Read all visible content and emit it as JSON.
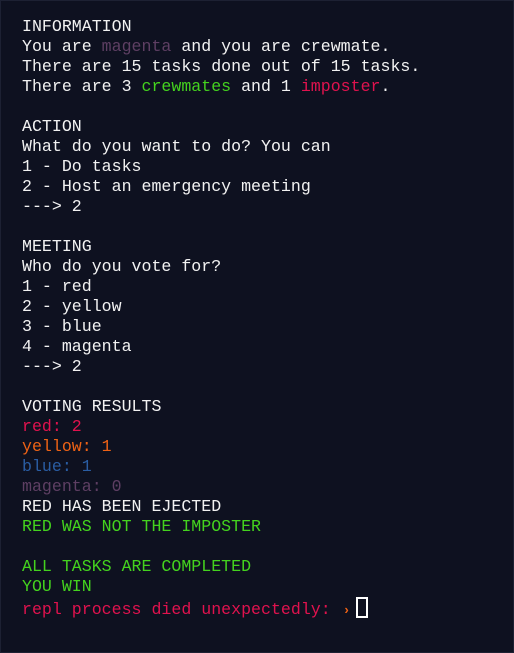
{
  "colors": {
    "background": "#0e1120",
    "text": "#f2f2f2",
    "magenta": "#5e3f63",
    "green": "#44d21e",
    "red": "#e0124e",
    "yellow": "#ee6215",
    "blue": "#2a5da3"
  },
  "information": {
    "heading": "INFORMATION",
    "line1": {
      "pre": "You are ",
      "color": "magenta",
      "post": " and you are crewmate."
    },
    "line2": "There are 15 tasks done out of 15 tasks.",
    "line3": {
      "pre": "There are 3 ",
      "crewmates": "crewmates",
      "mid": " and 1 ",
      "imposter": "imposter",
      "post": "."
    }
  },
  "action": {
    "heading": "ACTION",
    "prompt": "What do you want to do? You can",
    "options": [
      "1 - Do tasks",
      "2 - Host an emergency meeting"
    ],
    "answer": "---> 2"
  },
  "meeting": {
    "heading": "MEETING",
    "prompt": "Who do you vote for?",
    "options": [
      "1 - red",
      "2 - yellow",
      "3 - blue",
      "4 - magenta"
    ],
    "answer": "---> 2"
  },
  "voting_results": {
    "heading": "VOTING RESULTS",
    "results": [
      {
        "text": "red: 2"
      },
      {
        "text": "yellow: 1"
      },
      {
        "text": "blue: 1"
      },
      {
        "text": "magenta: 0"
      }
    ],
    "ejected": "RED HAS BEEN EJECTED",
    "not_imposter": "RED WAS NOT THE IMPOSTER"
  },
  "ending": {
    "completed": "ALL TASKS ARE COMPLETED",
    "win": "YOU WIN",
    "error": "repl process died unexpectedly: ",
    "prompt_icon": "›"
  }
}
